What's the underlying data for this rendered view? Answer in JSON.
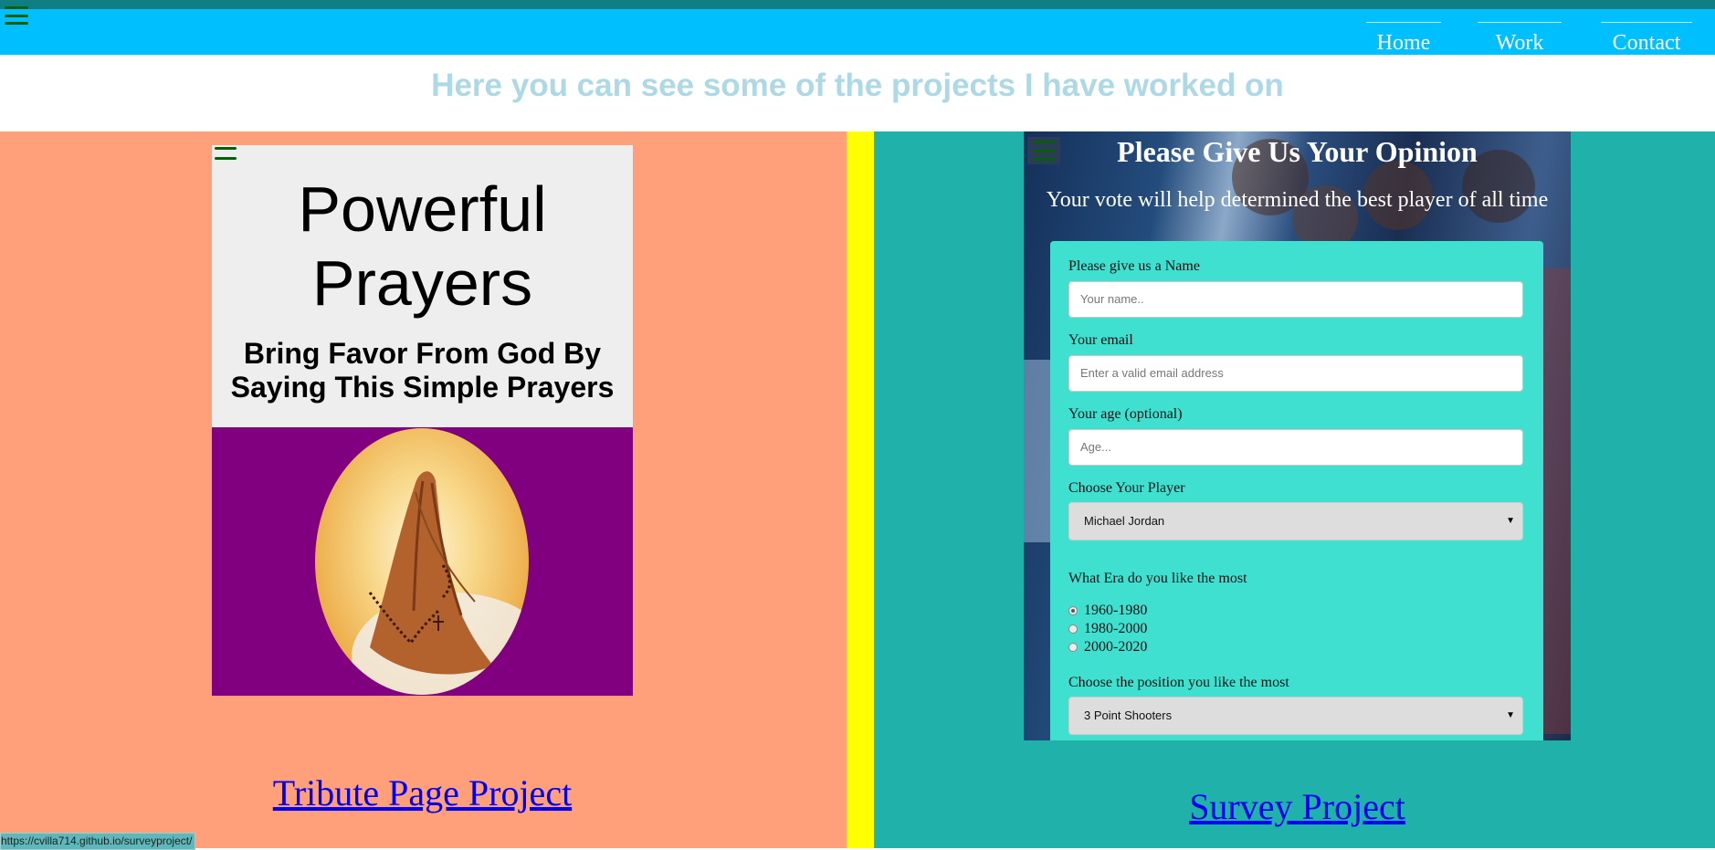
{
  "nav": {
    "items": [
      {
        "label": "Home"
      },
      {
        "label": "Work"
      },
      {
        "label": "Contact"
      }
    ]
  },
  "header": {
    "title": "Here you can see some of the projects I have worked on"
  },
  "tribute": {
    "title_line1": "Powerful",
    "title_line2": "Prayers",
    "subtitle_line1": "Bring Favor From God By",
    "subtitle_line2": "Saying This Simple Prayers",
    "link_label": "Tribute Page Project"
  },
  "survey": {
    "title": "Please Give Us Your Opinion",
    "description": "Your vote will help determined the best player of all time",
    "name_label": "Please give us a Name",
    "name_placeholder": "Your name..",
    "email_label": "Your email",
    "email_placeholder": "Enter a valid email address",
    "age_label": "Your age (optional)",
    "age_placeholder": "Age...",
    "player_label": "Choose Your Player",
    "player_value": "Michael Jordan",
    "era_label": "What Era do you like the most",
    "era_options": [
      {
        "label": "1960-1980",
        "checked": true
      },
      {
        "label": "1980-2000",
        "checked": false
      },
      {
        "label": "2000-2020",
        "checked": false
      }
    ],
    "position_label": "Choose the position you like the most",
    "position_value": "3 Point Shooters",
    "link_label": "Survey Project"
  },
  "status_bar": {
    "url": "https://cvilla714.github.io/surveyproject/"
  },
  "colors": {
    "nav_bg": "#00bfff",
    "header_text": "#add8e6",
    "left_pane": "#ffa07a",
    "divider": "#ffff00",
    "right_pane": "#20b2aa",
    "tribute_purple": "#800080",
    "survey_form": "#40e0d0",
    "link": "#0000ee"
  },
  "icons": [
    "hamburger-menu-icon",
    "praying-hands-image",
    "dropdown-arrow-icon"
  ]
}
